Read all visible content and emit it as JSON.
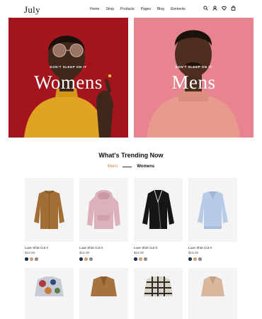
{
  "header": {
    "logo": "July",
    "nav": [
      "Home",
      "Shop",
      "Products",
      "Pages",
      "Blog",
      "Elements"
    ],
    "icons": [
      "search-icon",
      "user-icon",
      "heart-icon",
      "bag-icon"
    ]
  },
  "banners": [
    {
      "kicker": "DON'T SLEEP ON IT",
      "title": "Womens",
      "bg": "#a3141d"
    },
    {
      "kicker": "DON'T SLEEP ON IT",
      "title": "Mens",
      "bg": "#e6828e"
    }
  ],
  "trending": {
    "title": "What's Trending Now",
    "tabs": [
      "Mens",
      "Womens"
    ],
    "active_tab": "Mens"
  },
  "products": [
    {
      "name": "Luxe Shirt Cut II",
      "price": "$16.00",
      "swatches": [
        "#1c2f4a",
        "#c7a27a",
        "#8b8b8b"
      ],
      "garment": "jacket-tan"
    },
    {
      "name": "Luxe Shirt Cut II",
      "price": "$16.00",
      "swatches": [
        "#1c2f4a",
        "#c7a27a",
        "#8b8b8b"
      ],
      "garment": "hoodie-pink"
    },
    {
      "name": "Luxe Shirt Cut II",
      "price": "$16.00",
      "swatches": [
        "#1c2f4a",
        "#c7a27a",
        "#8b8b8b"
      ],
      "garment": "leather-black"
    },
    {
      "name": "Luxe Shirt Cut II",
      "price": "$16.00",
      "swatches": [
        "#1c2f4a",
        "#c7a27a",
        "#8b8b8b"
      ],
      "garment": "sweater-blue"
    }
  ],
  "more_products": [
    "floral-shirt",
    "camel-coat",
    "plaid-jacket",
    "beige-coat"
  ]
}
